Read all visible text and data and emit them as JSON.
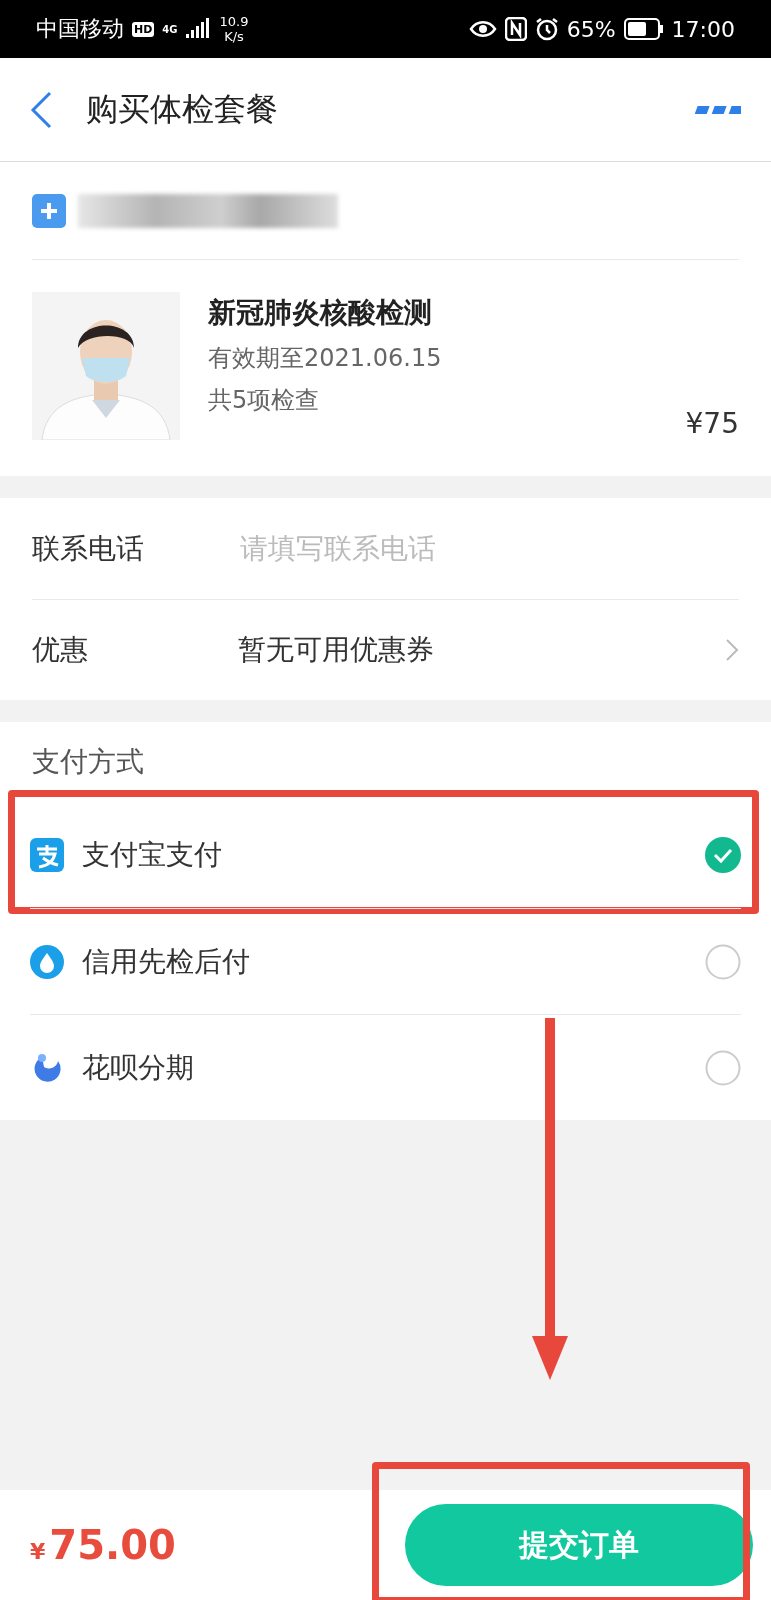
{
  "status_bar": {
    "carrier": "中国移动",
    "hd": "HD",
    "network": "4G",
    "speed": "10.9",
    "speed_unit": "K/s",
    "battery": "65%",
    "time": "17:00"
  },
  "header": {
    "title": "购买体检套餐"
  },
  "hospital": {
    "name_blurred": true
  },
  "product": {
    "name": "新冠肺炎核酸检测",
    "validity": "有效期至2021.06.15",
    "items": "共5项检查",
    "price": "¥75"
  },
  "form": [
    {
      "kind": "input",
      "label": "联系电话",
      "placeholder": "请填写联系电话"
    },
    {
      "kind": "select",
      "label": "优惠",
      "value": "暂无可用优惠券"
    }
  ],
  "payment": {
    "title": "支付方式",
    "options": [
      {
        "label": "支付宝支付",
        "kind": "alipay",
        "selected": true,
        "highlighted": true
      },
      {
        "label": "信用先检后付",
        "kind": "credit",
        "selected": false,
        "highlighted": false
      },
      {
        "label": "花呗分期",
        "kind": "installment",
        "selected": false,
        "highlighted": false
      }
    ]
  },
  "annotations": [
    {
      "kind": "arrow"
    }
  ],
  "footer": {
    "currency": "¥",
    "amount": "75.00",
    "submit": "提交订单",
    "submit_highlighted": true
  }
}
